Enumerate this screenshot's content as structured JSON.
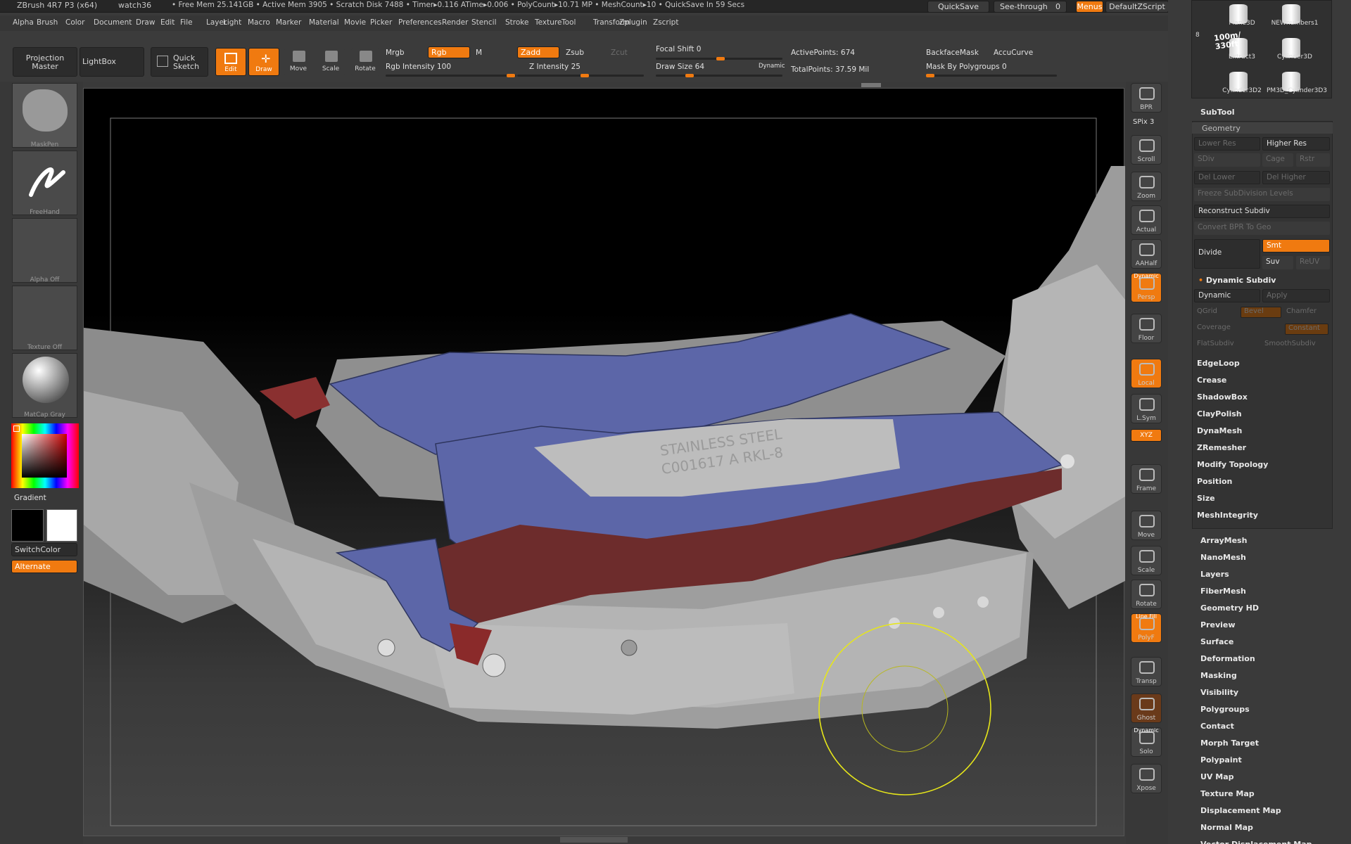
{
  "titlebar": {
    "app": "ZBrush 4R7 P3 (x64)",
    "doc": "watch36",
    "status": "• Free Mem 25.141GB • Active Mem 3905 • Scratch Disk 7488 •  Timer▸0.116 ATime▸0.006 • PolyCount▸10.71 MP • MeshCount▸10 • QuickSave In 59 Secs",
    "quicksave": "QuickSave",
    "seethrough": "See-through",
    "seethrough_value": "0",
    "menus": "Menus",
    "script": "DefaultZScript"
  },
  "menus": [
    "Alpha",
    "Brush",
    "Color",
    "Document",
    "Draw",
    "Edit",
    "File",
    "Layer",
    "Light",
    "Macro",
    "Marker",
    "Material",
    "Movie",
    "Picker",
    "Preferences",
    "Render",
    "Stencil",
    "Stroke",
    "Texture",
    "Tool",
    "Transform",
    "Zplugin",
    "Zscript"
  ],
  "toolbar": {
    "projection_master": "Projection Master",
    "lightbox": "LightBox",
    "quick_sketch": "Quick Sketch",
    "edit": "Edit",
    "draw": "Draw",
    "move": "Move",
    "scale": "Scale",
    "rotate": "Rotate",
    "mrgb": "Mrgb",
    "rgb": "Rgb",
    "m": "M",
    "rgb_intensity": "Rgb Intensity 100",
    "zadd": "Zadd",
    "zsub": "Zsub",
    "zcut": "Zcut",
    "z_intensity": "Z Intensity 25",
    "focal_shift": "Focal Shift 0",
    "draw_size": "Draw Size 64",
    "dynamic": "Dynamic",
    "active_points": "ActivePoints: 674",
    "total_points": "TotalPoints: 37.59 Mil",
    "backface_mask": "BackfaceMask",
    "accucurve": "AccuCurve",
    "mask_by_polygroups": "Mask By Polygroups 0"
  },
  "left": {
    "brush": "MaskPen",
    "stroke": "FreeHand",
    "alpha": "Alpha Off",
    "texture": "Texture Off",
    "material": "MatCap Gray",
    "gradient": "Gradient",
    "switchcolor": "SwitchColor",
    "alternate": "Alternate"
  },
  "viewport": {
    "engraving_line1": "STAINLESS STEEL",
    "engraving_line2": "C001617 A RKL-8"
  },
  "right_strip": [
    {
      "label": "BPR"
    },
    {
      "label": "SPix 3"
    },
    {
      "label": "Scroll"
    },
    {
      "label": "Zoom"
    },
    {
      "label": "Actual"
    },
    {
      "label": "AAHalf"
    },
    {
      "label": "Persp",
      "badge": "Dynamic"
    },
    {
      "label": "Floor"
    },
    {
      "label": "Local"
    },
    {
      "label": "L.Sym"
    },
    {
      "label": "XYZ"
    },
    {
      "label": "Frame"
    },
    {
      "label": "Move"
    },
    {
      "label": "Scale"
    },
    {
      "label": "Rotate"
    },
    {
      "label": "PolyF",
      "badge": "Line Fill"
    },
    {
      "label": "Transp"
    },
    {
      "label": "Ghost"
    },
    {
      "label": "Solo",
      "badge": "Dynamic"
    },
    {
      "label": "Xpose"
    }
  ],
  "subtool_thumbs": [
    "Plane3D",
    "NEWnumbers1",
    "Extract3",
    "Cylinder3D",
    "Cylinder3D2",
    "PM3D_Cylinder3D3"
  ],
  "subtool_count": "8",
  "thumb_text": "100m/ 330ft",
  "subtool_header": "SubTool",
  "geometry": {
    "header": "Geometry",
    "lower_res": "Lower Res",
    "higher_res": "Higher Res",
    "sdiv": "SDiv",
    "cage": "Cage",
    "rstr": "Rstr",
    "del_lower": "Del Lower",
    "del_higher": "Del Higher",
    "freeze": "Freeze SubDivision Levels",
    "reconstruct": "Reconstruct Subdiv",
    "convert_bpr": "Convert BPR To Geo",
    "divide": "Divide",
    "smt": "Smt",
    "suv": "Suv",
    "reuv": "ReUV",
    "dynamic_subdiv": "Dynamic Subdiv",
    "dynamic": "Dynamic",
    "apply": "Apply",
    "qgrid": "QGrid",
    "bevel": "Bevel",
    "chamfer": "Chamfer",
    "coverage": "Coverage",
    "constant": "Constant",
    "flatsubdiv": "FlatSubdiv",
    "smoothsubdiv": "SmoothSubdiv",
    "items": [
      "EdgeLoop",
      "Crease",
      "ShadowBox",
      "ClayPolish",
      "DynaMesh",
      "ZRemesher",
      "Modify Topology",
      "Position",
      "Size",
      "MeshIntegrity"
    ]
  },
  "tool_panels": [
    "ArrayMesh",
    "NanoMesh",
    "Layers",
    "FiberMesh",
    "Geometry HD",
    "Preview",
    "Surface",
    "Deformation",
    "Masking",
    "Visibility",
    "Polygroups",
    "Contact",
    "Morph Target",
    "Polypaint",
    "UV Map",
    "Texture Map",
    "Displacement Map",
    "Normal Map",
    "Vector Displacement Map"
  ]
}
